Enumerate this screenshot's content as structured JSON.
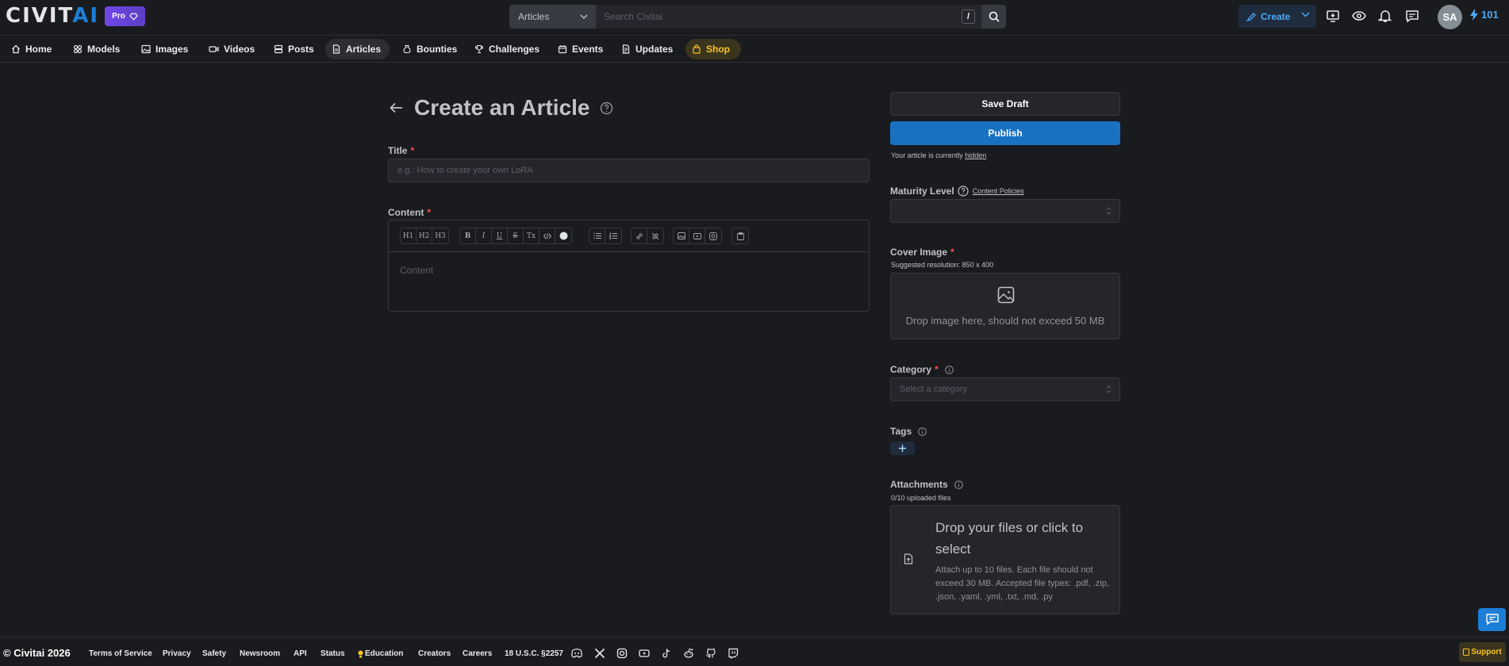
{
  "header": {
    "logo": {
      "main": "CIVIT",
      "accent": "AI"
    },
    "pro_badge": "Pro",
    "search": {
      "scope": "Articles",
      "placeholder": "Search Civitai",
      "shortcut": "/"
    },
    "create_label": "Create",
    "user_initials": "SA",
    "buzz_count": "101"
  },
  "nav": {
    "items": [
      {
        "label": "Home",
        "icon": "home-icon"
      },
      {
        "label": "Models",
        "icon": "models-icon"
      },
      {
        "label": "Images",
        "icon": "image-icon"
      },
      {
        "label": "Videos",
        "icon": "video-icon"
      },
      {
        "label": "Posts",
        "icon": "posts-icon"
      },
      {
        "label": "Articles",
        "icon": "article-icon",
        "active": true
      },
      {
        "label": "Bounties",
        "icon": "bounty-icon"
      },
      {
        "label": "Challenges",
        "icon": "trophy-icon"
      },
      {
        "label": "Events",
        "icon": "calendar-icon"
      },
      {
        "label": "Updates",
        "icon": "updates-icon"
      },
      {
        "label": "Shop",
        "icon": "shopping-bag-icon"
      }
    ]
  },
  "form": {
    "page_title": "Create an Article",
    "title_label": "Title",
    "title_placeholder": "e.g.: How to create your own LoRA",
    "content_label": "Content",
    "content_placeholder": "Content",
    "required_mark": "*",
    "toolbar": {
      "h1": "H1",
      "h2": "H2",
      "h3": "H3",
      "bold": "B",
      "italic": "I",
      "underline": "U",
      "strike": "S",
      "clear": "Tx"
    }
  },
  "sidebar": {
    "save_draft": "Save Draft",
    "publish": "Publish",
    "status_prefix": "Your article is currently",
    "status_value": "hidden",
    "maturity_label": "Maturity Level",
    "content_policies": "Content Policies",
    "cover_label": "Cover Image",
    "cover_hint": "Suggested resolution: 850 x 400",
    "cover_drop": "Drop image here, should not exceed 50 MB",
    "category_label": "Category",
    "category_placeholder": "Select a category",
    "tags_label": "Tags",
    "attachments_label": "Attachments",
    "attachments_count": "0/10 uploaded files",
    "attach_title": "Drop your files or click to select",
    "attach_desc": "Attach up to 10 files. Each file should not exceed 30 MB. Accepted file types: .pdf, .zip, .json, .yaml, .yml, .txt, .md, .py"
  },
  "footer": {
    "copyright": "© Civitai 2026",
    "links": [
      "Terms of Service",
      "Privacy",
      "Safety",
      "Newsroom",
      "API",
      "Status",
      "Education",
      "Creators",
      "Careers",
      "18 U.S.C. §2257"
    ],
    "support": "Support"
  },
  "colors": {
    "accent": "#1c7ed6",
    "publish": "#1971c2",
    "pro": "#7048e8",
    "shop": "#fcc419",
    "required": "#fa5252",
    "background": "#1a1b1e"
  }
}
